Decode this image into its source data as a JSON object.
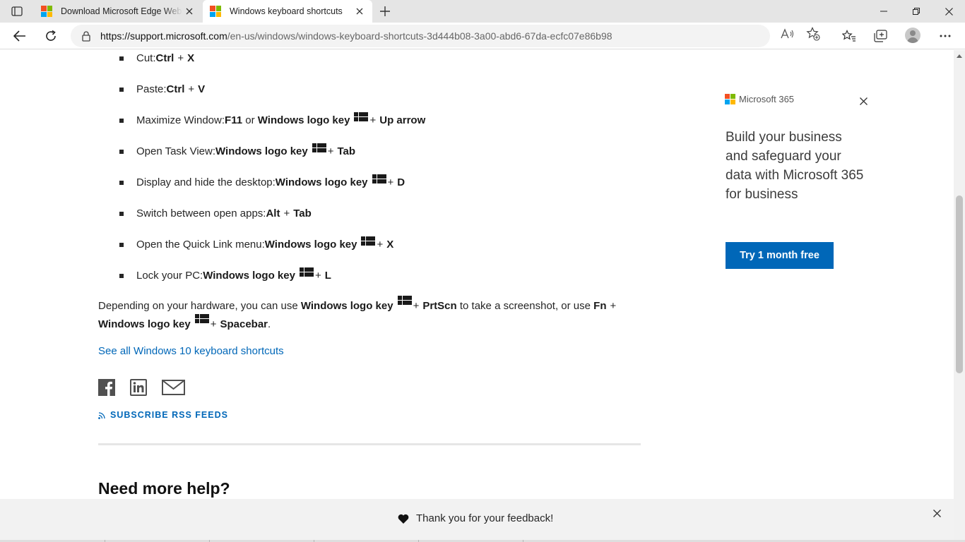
{
  "browser": {
    "tabs": [
      {
        "title": "Download Microsoft Edge Web B",
        "active": false
      },
      {
        "title": "Windows keyboard shortcuts",
        "active": true
      }
    ],
    "url_host": "https://support.microsoft.com",
    "url_path": "/en-us/windows/windows-keyboard-shortcuts-3d444b08-3a00-abd6-67da-ecfc07e86b98"
  },
  "shortcuts": [
    {
      "label": "Cut: ",
      "key1": "Ctrl",
      "plus1": "+",
      "key2": "X"
    },
    {
      "label": "Paste: ",
      "key1": "Ctrl",
      "plus1": "+",
      "key2": "V"
    },
    {
      "label": "Maximize Window: ",
      "key1": "F11",
      "or": "or",
      "key2": "Windows logo key",
      "plus1": "+",
      "key3": "Up arrow"
    },
    {
      "label": "Open Task View: ",
      "key1": "Windows logo key",
      "plus1": "+",
      "key2": "Tab"
    },
    {
      "label": "Display and hide the desktop: ",
      "key1": "Windows logo key",
      "plus1": "+",
      "key2": "D"
    },
    {
      "label": "Switch between open apps: ",
      "key1": "Alt",
      "plus1": "+",
      "key2": "Tab"
    },
    {
      "label": "Open the Quick Link menu: ",
      "key1": "Windows logo key",
      "plus1": "+",
      "key2": "X"
    },
    {
      "label": "Lock your PC: ",
      "key1": "Windows logo key",
      "plus1": "+",
      "key2": "L"
    }
  ],
  "paragraph": {
    "t1": "Depending on your hardware, you can use ",
    "k1": "Windows logo key",
    "plus": "+",
    "k2": "PrtScn",
    "t2": " to take a screenshot, or use ",
    "k3": "Fn",
    "k4": "Windows logo key",
    "k5": "Spacebar",
    "t3": "."
  },
  "see_all_link": "See all Windows 10 keyboard shortcuts",
  "rss_label": "SUBSCRIBE RSS FEEDS",
  "need_help": "Need more help?",
  "ad": {
    "brand": "Microsoft 365",
    "headline": "Build your business and safeguard your data with Microsoft 365 for business",
    "button": "Try 1 month free"
  },
  "feedback": {
    "message": "Thank you for your feedback!"
  },
  "colors": {
    "link": "#0067b8",
    "ms_red": "#f25022",
    "ms_green": "#7fba00",
    "ms_blue": "#00a4ef",
    "ms_yellow": "#ffb900"
  }
}
